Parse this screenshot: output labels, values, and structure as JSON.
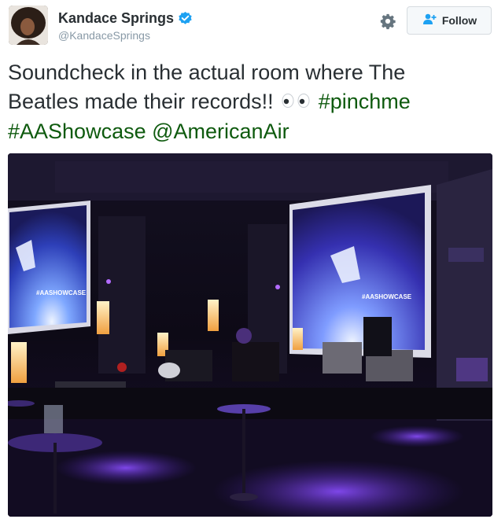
{
  "user": {
    "display_name": "Kandace Springs",
    "handle": "@KandaceSprings",
    "verified": true
  },
  "actions": {
    "follow_label": "Follow"
  },
  "tweet": {
    "text_part1": "Soundcheck in the actual room where The Beatles made their records!!",
    "hashtag1": "#pinchme",
    "hashtag2": "#AAShowcase",
    "mention": "@AmericanAir"
  },
  "photo": {
    "screen_caption_left": "#AASHOWCASE",
    "screen_caption_right": "#AASHOWCASE"
  },
  "colors": {
    "verified_blue": "#1da1f2",
    "hashtag_green": "#0e5a0e",
    "stage_purple": "#6a3cff"
  },
  "icons": [
    "gear-icon",
    "add-user-icon",
    "verified-badge-icon",
    "eyes-emoji-icon"
  ]
}
